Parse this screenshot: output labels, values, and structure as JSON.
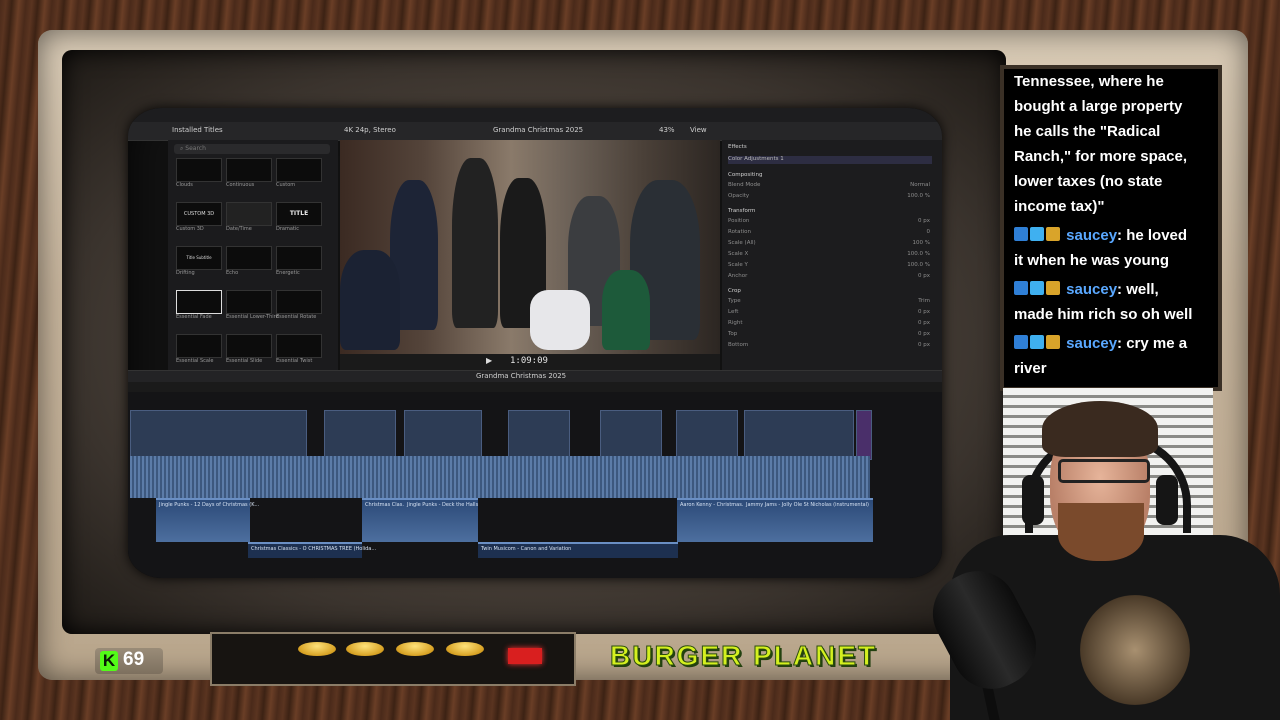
{
  "editor": {
    "browser_header": "Installed Titles",
    "search_placeholder": "Search",
    "viewer_format": "4K 24p, Stereo",
    "project_name": "Grandma Christmas 2025",
    "zoom": "43%",
    "view_label": "View",
    "timecode": "1:09:09",
    "timeline_project": "Grandma Christmas 2025",
    "titles": [
      {
        "name": "Clouds"
      },
      {
        "name": "Continuous"
      },
      {
        "name": "Custom"
      },
      {
        "name": "Custom 3D",
        "thumb_text": "CUSTOM 3D"
      },
      {
        "name": "Date/Time"
      },
      {
        "name": "Dramatic",
        "thumb_text": "TITLE"
      },
      {
        "name": "Drifting",
        "thumb_text": "Title Subtitle"
      },
      {
        "name": "Echo"
      },
      {
        "name": "Energetic"
      },
      {
        "name": "Essential Fade"
      },
      {
        "name": "Essential Lower-Third"
      },
      {
        "name": "Essential Rotate"
      },
      {
        "name": "Essential Scale"
      },
      {
        "name": "Essential Slide"
      },
      {
        "name": "Essential Twist"
      }
    ],
    "inspector": {
      "effects": "Effects",
      "color_adjustments": "Color Adjustments 1",
      "compositing": "Compositing",
      "blend_mode": "Blend Mode",
      "blend_value": "Normal",
      "opacity": "Opacity",
      "opacity_value": "100.0 %",
      "transform": "Transform",
      "position": "Position",
      "position_value": "0 px",
      "rotation": "Rotation",
      "rotation_value": "0",
      "scale_all": "Scale (All)",
      "scale_all_value": "100 %",
      "scale_x": "Scale X",
      "scale_x_value": "100.0 %",
      "scale_y": "Scale Y",
      "scale_y_value": "100.0 %",
      "anchor": "Anchor",
      "anchor_value": "0 px",
      "crop": "Crop",
      "type": "Type",
      "type_value": "Trim",
      "left": "Left",
      "right": "Right",
      "top": "Top",
      "bottom": "Bottom",
      "crop_value": "0 px"
    },
    "audio_clips": [
      "Jingle Punks - 12 Days of Christmas (K...",
      "Christmas Clas...",
      "Jingle Punks - Deck the Halls",
      "Aaron Kenny - Christmas...",
      "Jammy Jams - Jolly Ole St Nicholas (instrumental)"
    ],
    "lower_clips": [
      "Christmas Classics - O CHRISTMAS TREE (Holida...",
      "Twin Musicom - Canon and Variation"
    ]
  },
  "kick": {
    "icon_letter": "K",
    "viewer_count": "69",
    "brand_color": "#53fc18"
  },
  "brand_sign": "BURGER PLANET",
  "chat": {
    "lines": [
      {
        "text": "Tennessee, where he"
      },
      {
        "text": "bought a large property"
      },
      {
        "text": "he calls the \"Radical"
      },
      {
        "text": "Ranch,\" for more space,"
      },
      {
        "text": "lower taxes (no state"
      },
      {
        "text": "income tax)\""
      }
    ],
    "messages": [
      {
        "user": "saucey",
        "text": ": he loved",
        "cont": "it when he was young"
      },
      {
        "user": "saucey",
        "text": ": well,",
        "cont": "made him rich so oh well"
      },
      {
        "user": "saucey",
        "text": ": cry me a",
        "cont": "river"
      }
    ],
    "user_color": "#5aa8ff"
  }
}
